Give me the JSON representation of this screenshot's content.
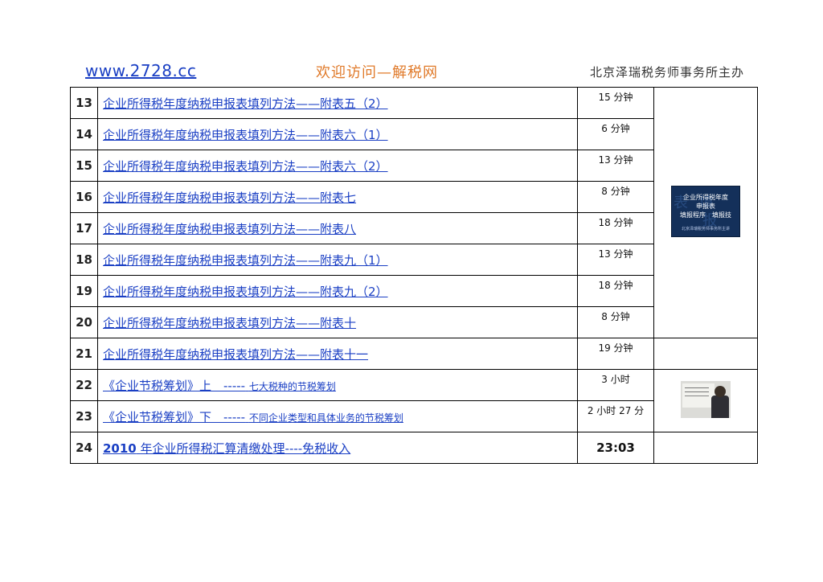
{
  "header": {
    "site": "www.2728.cc",
    "welcome": "欢迎访问—解税网",
    "host": "北京泽瑞税务师事务所主办"
  },
  "rows": [
    {
      "num": "13",
      "title": "企业所得税年度纳税申报表填列方法——附表五（2）",
      "duration": "15 分钟"
    },
    {
      "num": "14",
      "title": "企业所得税年度纳税申报表填列方法——附表六（1）",
      "duration": "6 分钟"
    },
    {
      "num": "15",
      "title": "企业所得税年度纳税申报表填列方法——附表六（2）",
      "duration": "13 分钟"
    },
    {
      "num": "16",
      "title": "企业所得税年度纳税申报表填列方法——附表七",
      "duration": "8 分钟"
    },
    {
      "num": "17",
      "title": "企业所得税年度纳税申报表填列方法——附表八",
      "duration": "18 分钟"
    },
    {
      "num": "18",
      "title": "企业所得税年度纳税申报表填列方法——附表九（1）",
      "duration": "13 分钟"
    },
    {
      "num": "19",
      "title": "企业所得税年度纳税申报表填列方法——附表九（2）",
      "duration": "18 分钟"
    },
    {
      "num": "20",
      "title": "企业所得税年度纳税申报表填列方法——附表十",
      "duration": "8 分钟"
    },
    {
      "num": "21",
      "title": "企业所得税年度纳税申报表填列方法——附表十一",
      "duration": "19 分钟"
    },
    {
      "num": "22",
      "title_main": "《企业节税筹划》上　-----",
      "title_sub": "七大税种的节税筹划",
      "duration": "3 小时"
    },
    {
      "num": "23",
      "title_main": "《企业节税筹划》下　-----",
      "title_sub": "不同企业类型和具体业务的节税筹划",
      "duration": "2 小时 27 分"
    },
    {
      "num": "24",
      "title_bold": "2010",
      "title_rest": "年企业所得税汇算清缴处理----免税收入",
      "duration": "23:03"
    }
  ],
  "thumbnails": {
    "tax_form": {
      "line1": "企业所得税年度",
      "line2": "申报表",
      "line3": "填报程序　填报技",
      "sub": "北京泽瑞税务师事务所主讲",
      "bg1": "表 填",
      "bg2": "报"
    }
  },
  "colors": {
    "link": "#1a3fc4",
    "welcome": "#e07a2a"
  }
}
